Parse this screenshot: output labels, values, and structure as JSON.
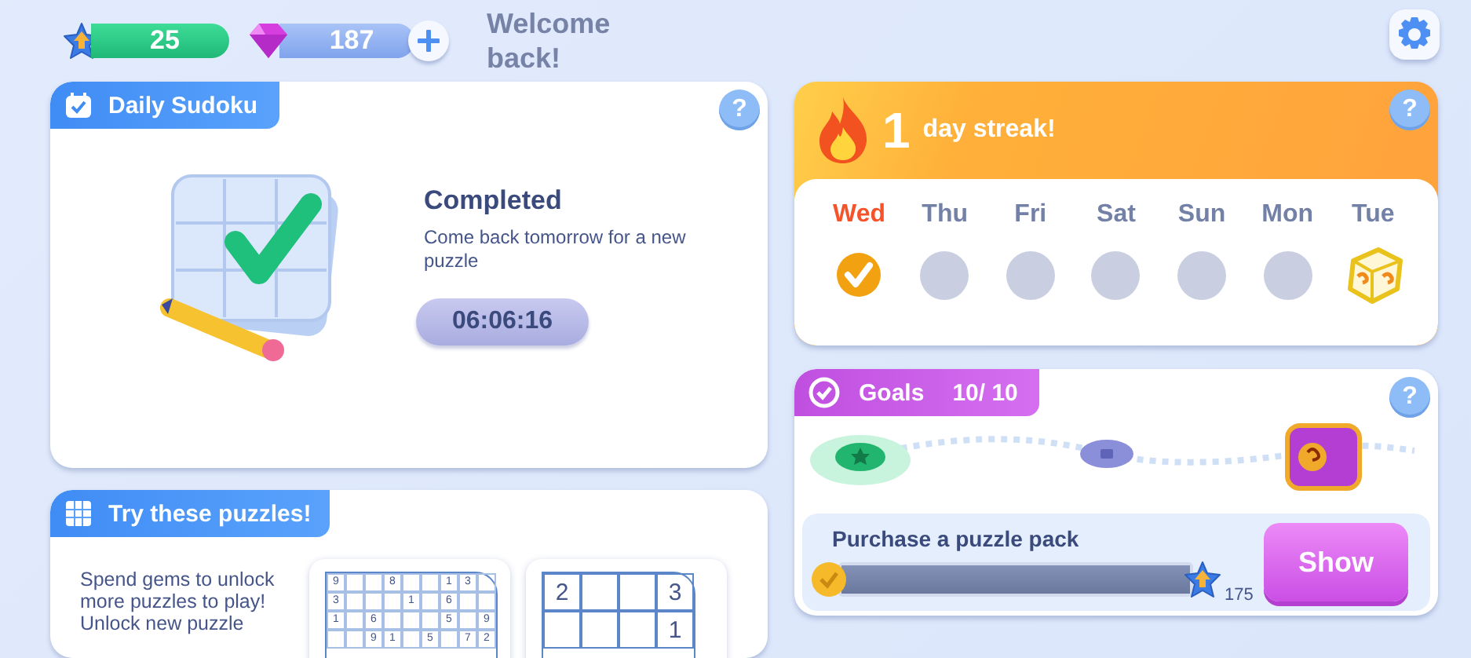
{
  "header": {
    "level_badge": "25",
    "gems": "187",
    "greeting": "Welcome back!"
  },
  "daily_sudoku": {
    "title": "Daily Sudoku",
    "help": "?",
    "status": "Completed",
    "message": "Come back tomorrow for a new puzzle",
    "timer": "06:06:16"
  },
  "streak": {
    "count": "1",
    "label": "day streak!",
    "help": "?",
    "days": [
      {
        "label": "Wed",
        "kind": "done",
        "selected": true
      },
      {
        "label": "Thu",
        "kind": "pending",
        "selected": false
      },
      {
        "label": "Fri",
        "kind": "pending",
        "selected": false
      },
      {
        "label": "Sat",
        "kind": "pending",
        "selected": false
      },
      {
        "label": "Sun",
        "kind": "pending",
        "selected": false
      },
      {
        "label": "Mon",
        "kind": "pending",
        "selected": false
      },
      {
        "label": "Tue",
        "kind": "reward",
        "selected": false
      }
    ]
  },
  "goals": {
    "title": "Goals",
    "progress": "10/ 10",
    "help": "?",
    "task": "Purchase a puzzle pack",
    "level": 1,
    "reward": "175",
    "button": "Show"
  },
  "puzzles": {
    "title": "Try these puzzles!",
    "description": "Spend gems to unlock more puzzles to play!",
    "description_2": "Unlock new puzzle",
    "previews": [
      {
        "rows": [
          [
            "9",
            null,
            null,
            "8",
            null,
            null,
            "1",
            "3",
            null
          ],
          [
            "3",
            null,
            null,
            null,
            "1",
            null,
            "6",
            null,
            null
          ],
          [
            "1",
            null,
            "6",
            null,
            null,
            null,
            "5",
            null,
            "9"
          ],
          [
            null,
            null,
            "9",
            "1",
            null,
            "5",
            null,
            "7",
            "2"
          ]
        ]
      },
      {
        "rows": [
          [
            "2",
            null,
            null,
            "3"
          ],
          [
            null,
            null,
            null,
            "1"
          ]
        ]
      }
    ]
  }
}
